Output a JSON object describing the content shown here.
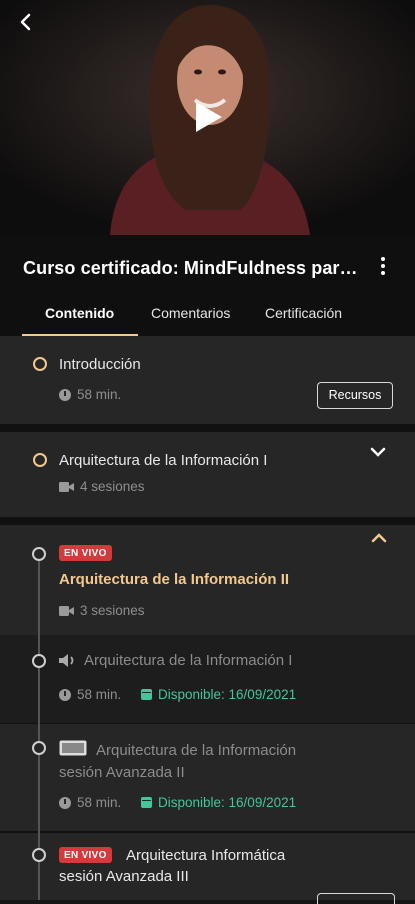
{
  "course": {
    "title": "Curso certificado: MindFuldness para..."
  },
  "tabs": [
    {
      "label": "Contenido"
    },
    {
      "label": "Comentarios"
    },
    {
      "label": "Certificación"
    }
  ],
  "colors": {
    "accent": "#f2c88d",
    "live": "#d23b3b",
    "available": "#43c69b"
  },
  "items": [
    {
      "title": "Introducción",
      "duration": "58 min.",
      "resources_label": "Recursos"
    },
    {
      "title": "Arquitectura de la Información I",
      "sessions": "4 sesiones"
    },
    {
      "badge": "EN VIVO",
      "title": "Arquitectura de la Información II",
      "sessions": "3 sesiones",
      "subitems": [
        {
          "title": "Arquitectura de la Información I",
          "icon": "speaker-icon",
          "duration": "58 min.",
          "available": "Disponible: 16/09/2021"
        },
        {
          "title_line1": "Arquitectura de la Información",
          "title_line2": "sesión Avanzada II",
          "icon": "image-icon",
          "duration": "58 min.",
          "available": "Disponible: 16/09/2021"
        },
        {
          "badge": "EN VIVO",
          "title_line1": "Arquitectura Informática",
          "title_line2": "sesión Avanzada III"
        }
      ]
    }
  ]
}
